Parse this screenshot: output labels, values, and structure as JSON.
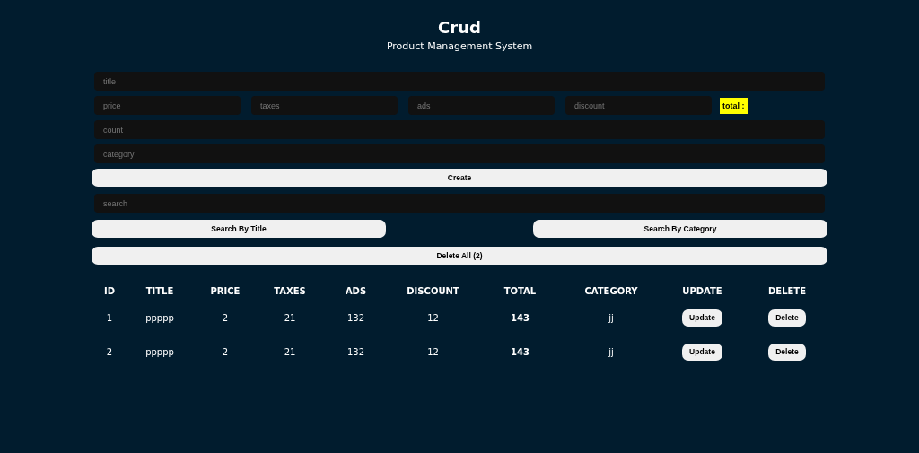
{
  "header": {
    "title": "Crud",
    "subtitle": "Product Management System"
  },
  "form": {
    "title": {
      "placeholder": "title"
    },
    "prices": [
      {
        "placeholder": "price"
      },
      {
        "placeholder": "taxes"
      },
      {
        "placeholder": "ads"
      },
      {
        "placeholder": "discount"
      }
    ],
    "total": "total :",
    "count": {
      "placeholder": "count"
    },
    "category": {
      "placeholder": "category"
    },
    "create_button": "Create"
  },
  "search": {
    "placeholder": "search"
  },
  "search_buttons": [
    "Search By Title",
    "Search By Category"
  ],
  "delete_all_button": "Delete All (2)",
  "table": {
    "columns": [
      "ID",
      "TITLE",
      "PRICE",
      "TAXES",
      "ADS",
      "DISCOUNT",
      "TOTAL",
      "CATEGORY",
      "UPDATE",
      "DELETE"
    ],
    "rows": [
      {
        "id": "1",
        "title": "ppppp",
        "price": "2",
        "taxes": "21",
        "ads": "132",
        "discount": "12",
        "total": "143",
        "category": "jj",
        "update": "Update",
        "delete": "Delete"
      },
      {
        "id": "2",
        "title": "ppppp",
        "price": "2",
        "taxes": "21",
        "ads": "132",
        "discount": "12",
        "total": "143",
        "category": "jj",
        "update": "Update",
        "delete": "Delete"
      }
    ]
  }
}
